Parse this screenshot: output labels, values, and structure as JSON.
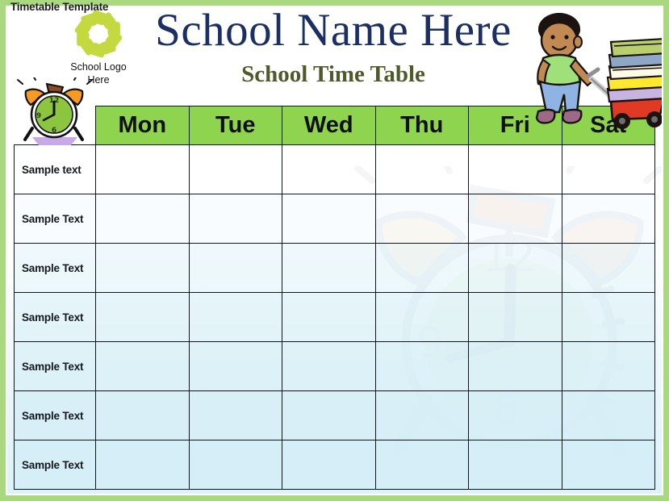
{
  "document": {
    "caption": "Timetable Template"
  },
  "header": {
    "logo": {
      "icon": "flower-pinwheel-logo",
      "caption_line1": "School Logo",
      "caption_line2": "Here"
    },
    "title": "School Name Here",
    "subtitle": "School Time Table",
    "decorations": {
      "alarm_clock": "alarm-clock-illustration",
      "boy_with_wagon": "boy-pulling-book-wagon-illustration"
    }
  },
  "timetable": {
    "corner_label": "",
    "day_columns": [
      "Mon",
      "Tue",
      "Wed",
      "Thu",
      "Fri",
      "Sat"
    ],
    "rows": [
      {
        "label": "Sample text",
        "cells": [
          "",
          "",
          "",
          "",
          "",
          ""
        ]
      },
      {
        "label": "Sample Text",
        "cells": [
          "",
          "",
          "",
          "",
          "",
          ""
        ]
      },
      {
        "label": "Sample Text",
        "cells": [
          "",
          "",
          "",
          "",
          "",
          ""
        ]
      },
      {
        "label": "Sample Text",
        "cells": [
          "",
          "",
          "",
          "",
          "",
          ""
        ]
      },
      {
        "label": "Sample Text",
        "cells": [
          "",
          "",
          "",
          "",
          "",
          ""
        ]
      },
      {
        "label": "Sample Text",
        "cells": [
          "",
          "",
          "",
          "",
          "",
          ""
        ]
      },
      {
        "label": "Sample Text",
        "cells": [
          "",
          "",
          "",
          "",
          "",
          ""
        ]
      }
    ],
    "watermark": "alarm-clock-watermark",
    "watermark_numerals": [
      "12",
      "9",
      "6"
    ]
  },
  "colors": {
    "frame_green": "#a9d87e",
    "header_green": "#8fd44f",
    "title_navy": "#1b2f63",
    "subtitle_olive": "#4e5a29",
    "grid_line": "#11161c",
    "row_tint": "#d4eef6",
    "logo_green": "#c3d93f",
    "clock_face_green": "#8cc63f",
    "clock_bell_orange": "#f59a24",
    "clock_base_purple": "#c9a8e8",
    "wagon_red": "#e03a25",
    "shirt_green": "#9fe07a",
    "jeans_blue": "#8fb3e3",
    "skin_brown": "#c08a52"
  }
}
